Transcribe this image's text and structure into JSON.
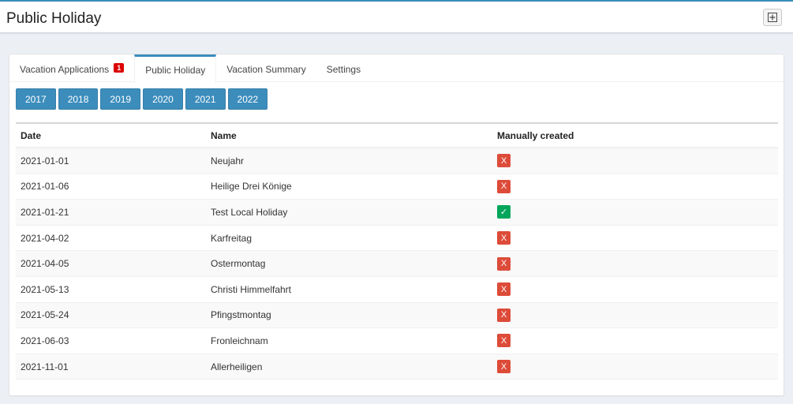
{
  "header": {
    "title": "Public Holiday"
  },
  "tabs": [
    {
      "label": "Vacation Applications",
      "badge": "1"
    },
    {
      "label": "Public Holiday"
    },
    {
      "label": "Vacation Summary"
    },
    {
      "label": "Settings"
    }
  ],
  "years": [
    "2017",
    "2018",
    "2019",
    "2020",
    "2021",
    "2022"
  ],
  "table": {
    "headers": {
      "date": "Date",
      "name": "Name",
      "manual": "Manually created"
    },
    "rows": [
      {
        "date": "2021-01-01",
        "name": "Neujahr",
        "manual": "X",
        "manual_state": "no"
      },
      {
        "date": "2021-01-06",
        "name": "Heilige Drei Könige",
        "manual": "X",
        "manual_state": "no"
      },
      {
        "date": "2021-01-21",
        "name": "Test Local Holiday",
        "manual": "✓",
        "manual_state": "yes"
      },
      {
        "date": "2021-04-02",
        "name": "Karfreitag",
        "manual": "X",
        "manual_state": "no"
      },
      {
        "date": "2021-04-05",
        "name": "Ostermontag",
        "manual": "X",
        "manual_state": "no"
      },
      {
        "date": "2021-05-13",
        "name": "Christi Himmelfahrt",
        "manual": "X",
        "manual_state": "no"
      },
      {
        "date": "2021-05-24",
        "name": "Pfingstmontag",
        "manual": "X",
        "manual_state": "no"
      },
      {
        "date": "2021-06-03",
        "name": "Fronleichnam",
        "manual": "X",
        "manual_state": "no"
      },
      {
        "date": "2021-11-01",
        "name": "Allerheiligen",
        "manual": "X",
        "manual_state": "no"
      }
    ]
  },
  "colors": {
    "accent": "#3c8dbc",
    "danger": "#dd4b39",
    "success": "#00a65a",
    "badge": "#dd0000"
  },
  "icons": {
    "expand": "plus-square-icon"
  }
}
